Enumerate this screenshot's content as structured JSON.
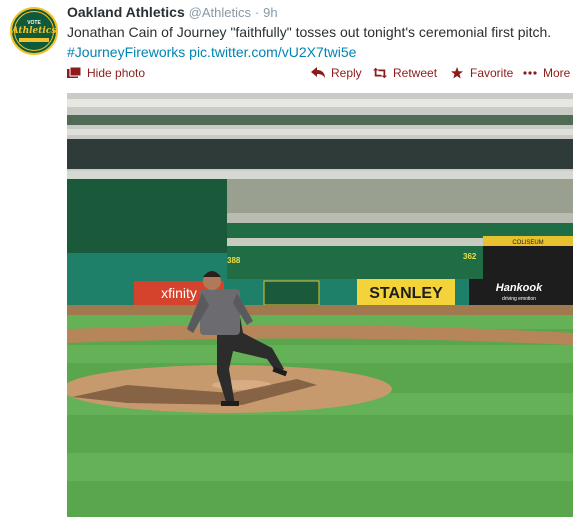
{
  "tweet": {
    "author_name": "Oakland Athletics",
    "author_handle": "@Athletics",
    "separator": "·",
    "time": "9h",
    "text": "Jonathan Cain of Journey \"faithfully\" tosses out tonight's ceremonial first pitch.",
    "hashtag": "#JourneyFireworks",
    "link": "pic.twitter.com/vU2X7twi5e"
  },
  "avatar": {
    "top_text": "VOTE",
    "logo_text": "Athletics"
  },
  "actions": {
    "hide_photo": "Hide photo",
    "reply": "Reply",
    "retweet": "Retweet",
    "favorite": "Favorite",
    "more": "More"
  },
  "photo": {
    "signs": {
      "xfinity": "xfinity",
      "stanley": "STANLEY",
      "hankook": "Hankook",
      "hankook_tag": "driving emotion",
      "coliseum": "COLISEUM",
      "dist_left": "388",
      "dist_right": "362"
    }
  },
  "colors": {
    "link": "#0084b4",
    "action": "#8c1b1b",
    "muted": "#8899a6",
    "grass": "#5aa64c",
    "wall": "#1f8069"
  },
  "icons": {
    "hide": "photo-icon",
    "reply": "reply-icon",
    "retweet": "retweet-icon",
    "favorite": "star-icon",
    "more": "ellipsis-icon"
  }
}
